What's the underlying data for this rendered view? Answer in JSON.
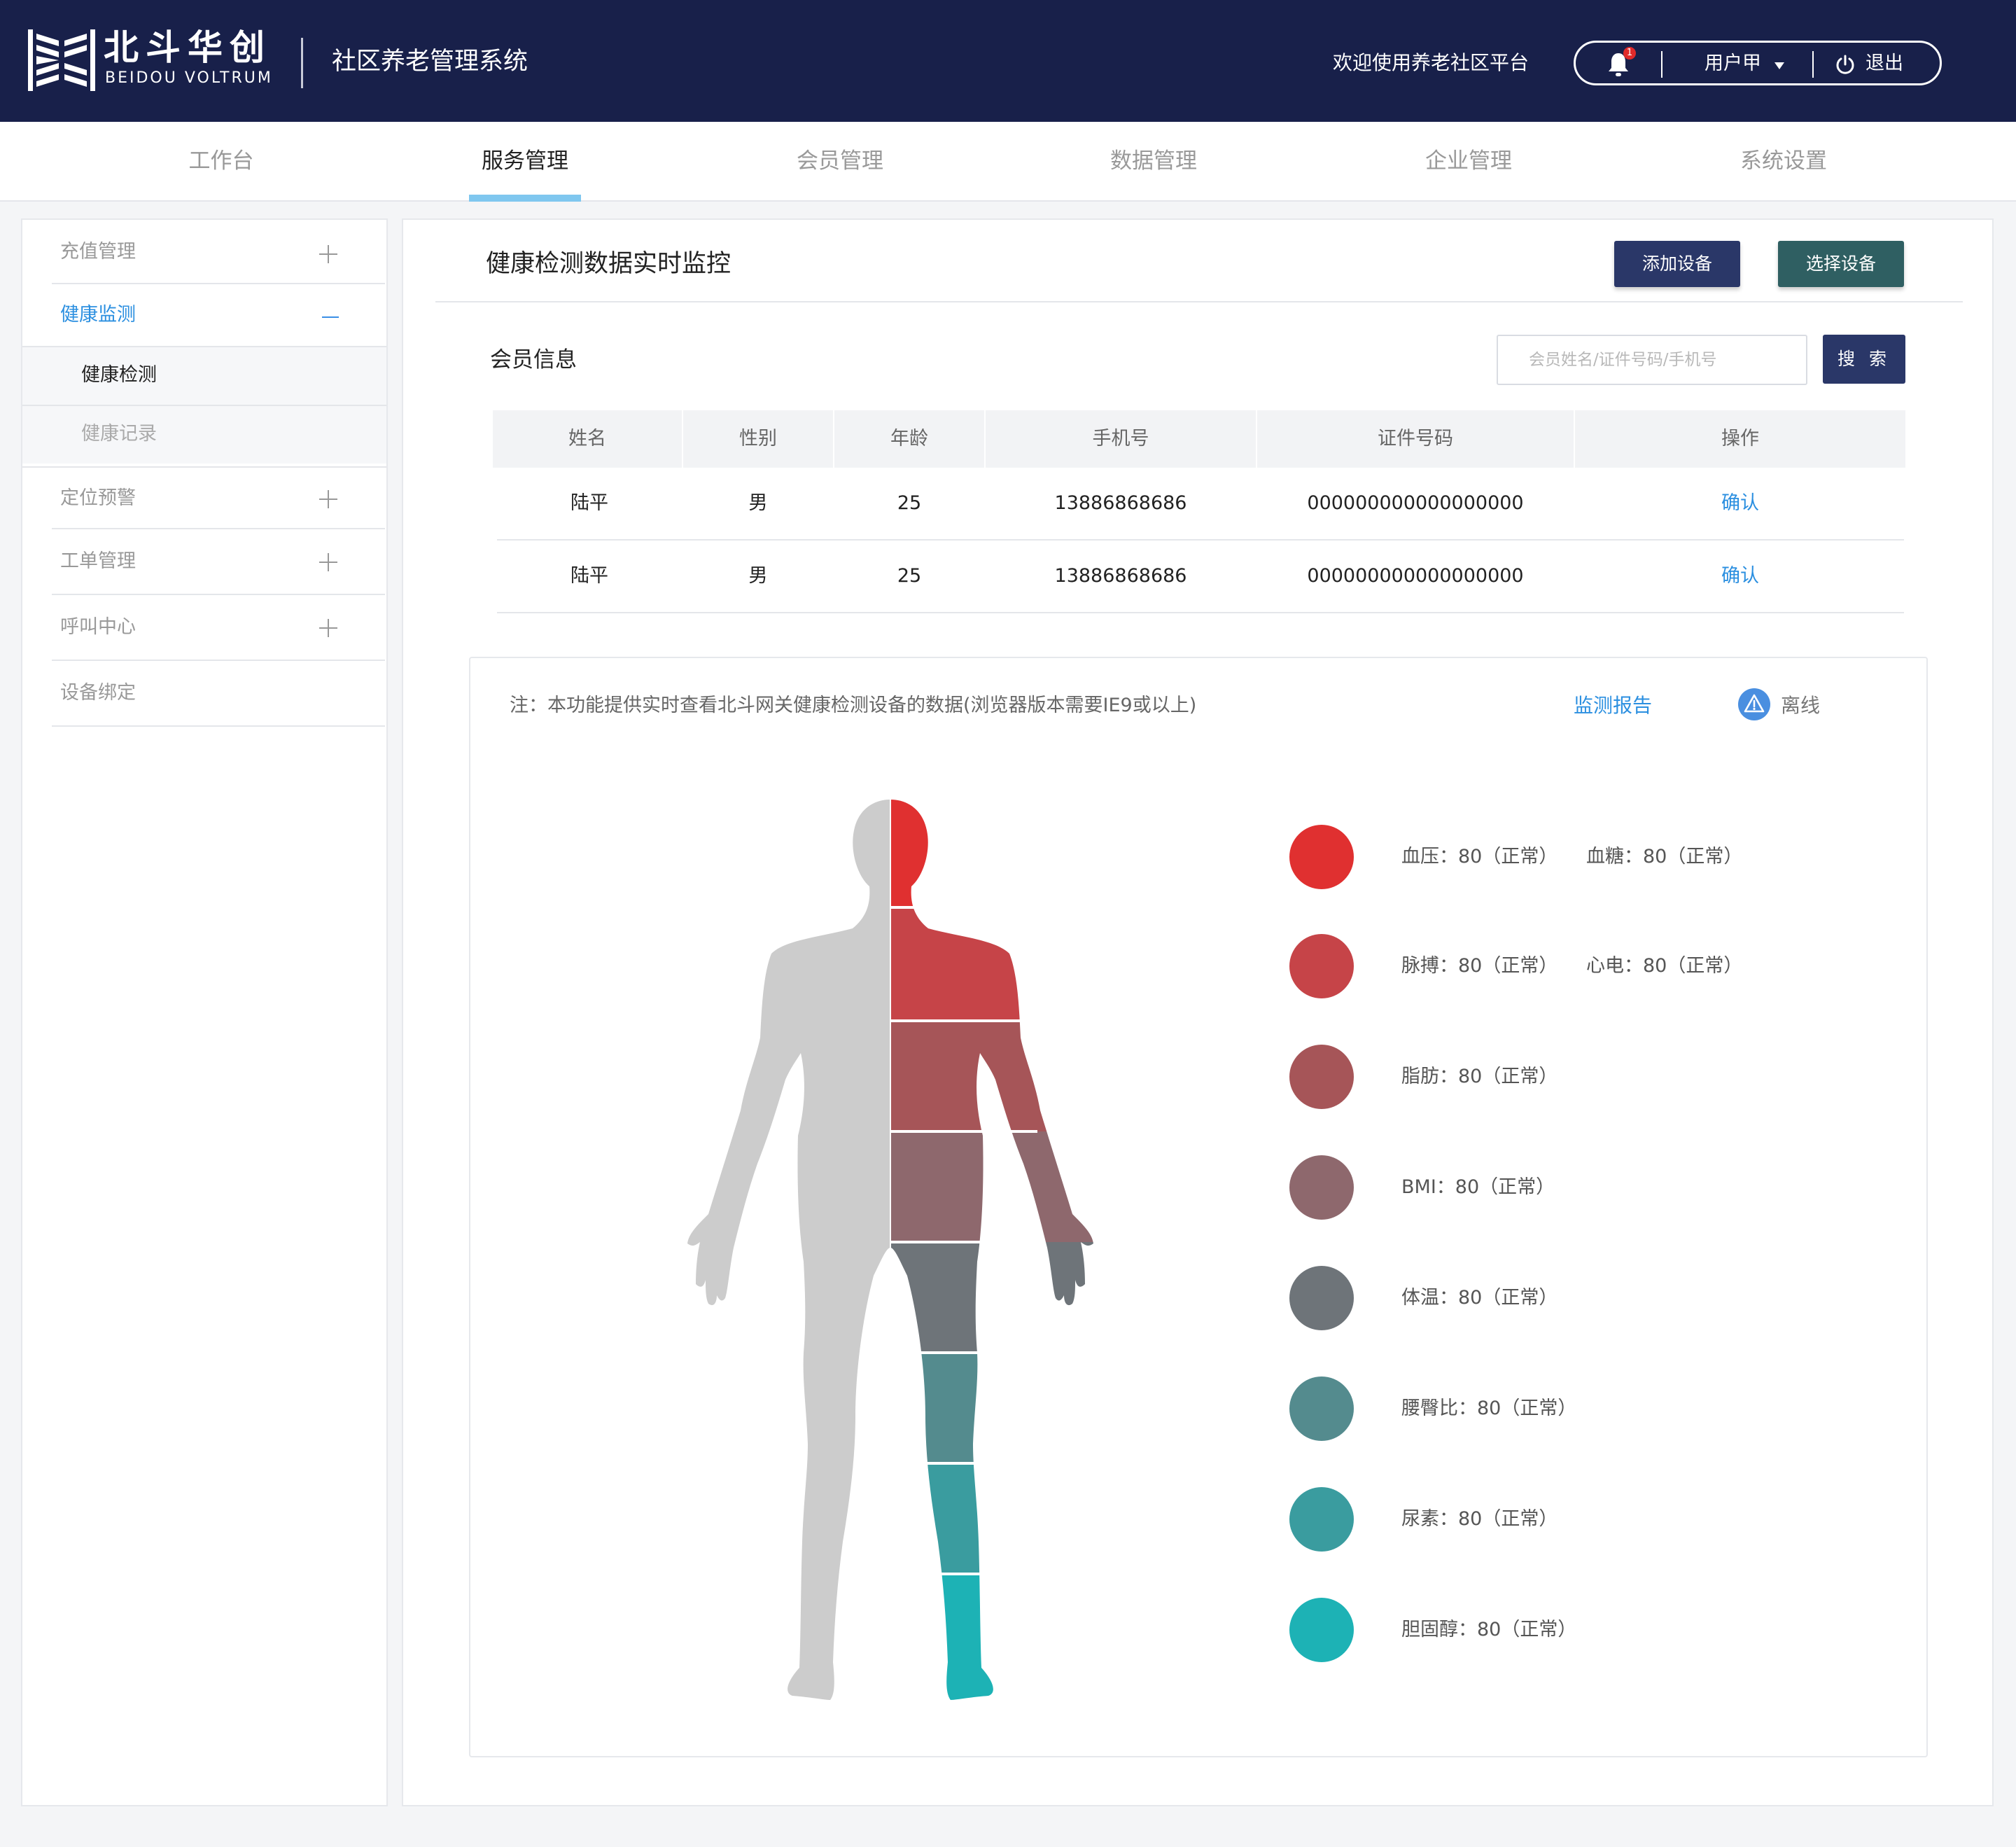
{
  "header": {
    "brand_cn": "北斗华创",
    "brand_en": "BEIDOU VOLTRUM",
    "system_title": "社区养老管理系统",
    "welcome": "欢迎使用养老社区平台",
    "notification_count": "1",
    "user_name": "用户甲",
    "logout_label": "退出"
  },
  "nav": {
    "tabs": [
      {
        "label": "工作台"
      },
      {
        "label": "服务管理"
      },
      {
        "label": "会员管理"
      },
      {
        "label": "数据管理"
      },
      {
        "label": "企业管理"
      },
      {
        "label": "系统设置"
      }
    ],
    "active_index": 1
  },
  "sidebar": {
    "items": [
      {
        "label": "充值管理"
      },
      {
        "label": "健康监测"
      },
      {
        "label": "定位预警"
      },
      {
        "label": "工单管理"
      },
      {
        "label": "呼叫中心"
      },
      {
        "label": "设备绑定"
      }
    ],
    "sub_items": [
      {
        "label": "健康检测"
      },
      {
        "label": "健康记录"
      }
    ]
  },
  "main": {
    "title": "健康检测数据实时监控",
    "add_device_label": "添加设备",
    "select_device_label": "选择设备",
    "member_section_title": "会员信息",
    "search_placeholder": "会员姓名/证件号码/手机号",
    "search_button_label": "搜 索"
  },
  "table": {
    "columns": [
      "姓名",
      "性别",
      "年龄",
      "手机号",
      "证件号码",
      "操作"
    ],
    "rows": [
      {
        "name": "陆平",
        "gender": "男",
        "age": "25",
        "phone": "13886868686",
        "id_number": "000000000000000000",
        "action": "确认"
      },
      {
        "name": "陆平",
        "gender": "男",
        "age": "25",
        "phone": "13886868686",
        "id_number": "000000000000000000",
        "action": "确认"
      }
    ]
  },
  "monitor": {
    "notice": "注：本功能提供实时查看北斗网关健康检测设备的数据(浏览器版本需要IE9或以上)",
    "report_link": "监测报告",
    "status_label": "离线",
    "metrics": [
      {
        "color": "#e03030",
        "items": [
          "血压：80（正常）",
          "血糖：80（正常）"
        ]
      },
      {
        "color": "#c64448",
        "items": [
          "脉搏：80（正常）",
          "心电：80（正常）"
        ]
      },
      {
        "color": "#a65558",
        "items": [
          "脂肪：80（正常）"
        ]
      },
      {
        "color": "#8e686d",
        "items": [
          "BMI：80（正常）"
        ]
      },
      {
        "color": "#6e7479",
        "items": [
          "体温：80（正常）"
        ]
      },
      {
        "color": "#548b8e",
        "items": [
          "腰臀比：80（正常）"
        ]
      },
      {
        "color": "#3a9c9f",
        "items": [
          "尿素：80（正常）"
        ]
      },
      {
        "color": "#1db2b5",
        "items": [
          "胆固醇：80（正常）"
        ]
      }
    ]
  },
  "colors": {
    "header_bg": "#18204a",
    "accent_blue": "#2b8fe0",
    "primary_button": "#2a3768",
    "secondary_button": "#2f5f62",
    "nav_underline": "#7fc7ef",
    "body_left_gray": "#cccccc"
  }
}
